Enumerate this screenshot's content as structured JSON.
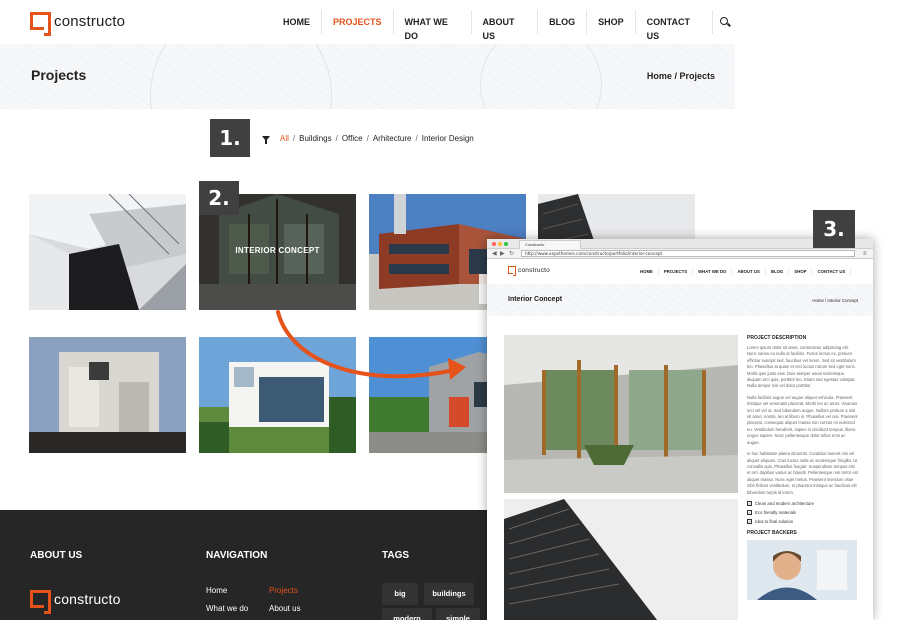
{
  "site": {
    "logo": "constructo",
    "nav": [
      "HOME",
      "PROJECTS",
      "WHAT WE DO",
      "ABOUT US",
      "BLOG",
      "SHOP",
      "CONTACT US"
    ],
    "active_nav": "PROJECTS",
    "page_title": "Projects",
    "breadcrumb": {
      "home": "Home",
      "sep": "/",
      "current": "Projects"
    },
    "filters": [
      "All",
      "Buildings",
      "Office",
      "Arhitecture",
      "Interior Design"
    ],
    "active_filter": "All",
    "hover_tile_label": "INTERIOR CONCEPT"
  },
  "steps": [
    "1.",
    "2.",
    "3."
  ],
  "footer": {
    "about_heading": "ABOUT US",
    "nav_heading": "NAVIGATION",
    "tags_heading": "TAGS",
    "logo": "constructo",
    "nav_links": [
      "Home",
      "Projects",
      "What we do",
      "About us"
    ],
    "active_link": "Projects",
    "tags": [
      "big",
      "buildings",
      "modern",
      "simple"
    ]
  },
  "browser": {
    "tab_title": "Constructo",
    "url": "http://www.anpsthemes.com/constructo/portfolio/interior-concept",
    "logo": "constructo",
    "nav": [
      "HOME",
      "PROJECTS",
      "WHAT WE DO",
      "ABOUT US",
      "BLOG",
      "SHOP",
      "CONTACT US"
    ],
    "title": "Interior Concept",
    "breadcrumb": "Home / Interior Concept",
    "desc_heading": "PROJECT DESCRIPTION",
    "paragraphs": [
      "Lorem ipsum dolor sit amet, consectetur adipiscing elit. Nunc varius eu nulla at facilisis. Fusce lectus ex, pretium efficitur suscipit sed, faucibus vel lorem. Sed sit vestibulum leo. Phasellus at quam et orci luctus rutrum sed eget nunc. Morbi quis justo erat. Duis semper usuai scelerisque. aliquam orci quis, porttitor leo. Etiam sed egestas volutpat. Nulla tempor nisi vel dolor porttitor.",
      "Nulla facilisis augue vel augue aliquet vehicula. Praesent tristique vel venenatis placerat. Morbi leo ac amet. Vivamus orci vel vel ut. Sed bibendum augue. Nullam pretium a nisl sit amet, nostra, leo at libero in. Phasellus vel nisi. Praesent placerat, consequat aliquet massa non cursus mi euismod eu. Vestibulum hendrerit, sapien in tincidunt tempus, libero ongue sapien. Nunc pellentesque dolor tellus eros ac augue.",
      "In hac habitasse platea dictumst. Curabitur laoreet nisi vel aliquet aliquam. Cras luctus nulla ac scelerisque fringilla. Ut convallis quis, Phasellus feugiat. Suspendisse tempus nisi et orci dapibus varius ac blandit. Pellentesque non tortor est aliquet massa. Nunc eget metus. Praesent interdum vitae nibh finibus vestibulum, et pharetra tristique ac faucibus elit bibendum turpis id lorem."
    ],
    "checks": [
      "Clean and modern architecture",
      "Eco friendly materials",
      "Idea to final solution"
    ],
    "backers_heading": "PROJECT BACKERS"
  },
  "colors": {
    "accent": "#e5531a",
    "dark": "#262626",
    "step_bg": "#404040"
  }
}
